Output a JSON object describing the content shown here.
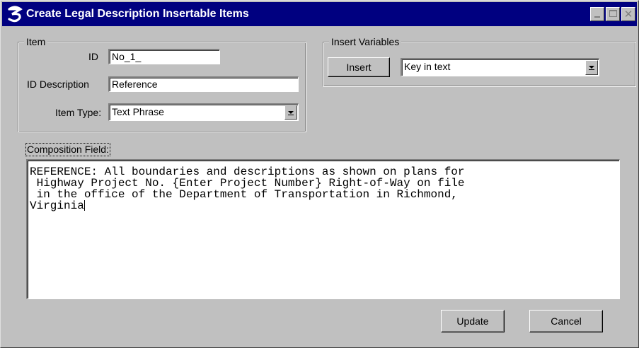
{
  "window": {
    "title": "Create Legal Description Insertable Items"
  },
  "item_group": {
    "title": "Item",
    "id_label": "ID",
    "id_value": "No_1_",
    "description_label": "ID Description",
    "description_value": "Reference",
    "type_label": "Item Type:",
    "type_value": "Text Phrase"
  },
  "insert_group": {
    "title": "Insert Variables",
    "insert_button": "Insert",
    "variable_value": "Key in text"
  },
  "composition": {
    "label": "Composition Field:",
    "lines": [
      "REFERENCE: All boundaries and descriptions as shown on plans for",
      " Highway Project No. {Enter Project Number} Right-of-Way on file",
      " in the office of the Department of Transportation in Richmond,",
      "Virginia"
    ]
  },
  "buttons": {
    "update": "Update",
    "cancel": "Cancel"
  },
  "icons": {
    "app": "app-logo-icon",
    "minimize": "minimize-icon",
    "maximize": "maximize-icon",
    "close": "close-icon",
    "dropdown": "chevron-down-icon"
  },
  "colors": {
    "titlebar": "#000080",
    "window_bg": "#c0c0c0",
    "field_bg": "#ffffff"
  }
}
